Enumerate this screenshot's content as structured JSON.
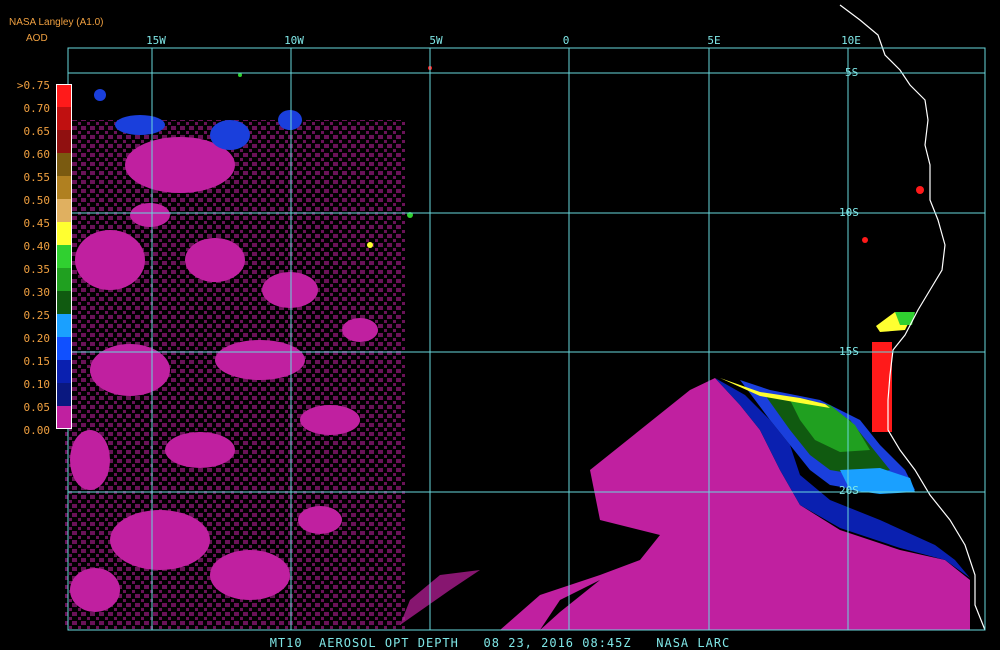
{
  "header": {
    "source": "NASA Langley (A1.0)",
    "product": "AOD"
  },
  "longitude_labels": [
    "15W",
    "10W",
    "5W",
    "0",
    "5E",
    "10E"
  ],
  "latitude_labels": [
    "5S",
    "10S",
    "15S",
    "20S"
  ],
  "legend": {
    "labels": [
      ">0.75",
      "0.70",
      "0.65",
      "0.60",
      "0.55",
      "0.50",
      "0.45",
      "0.40",
      "0.35",
      "0.30",
      "0.25",
      "0.20",
      "0.15",
      "0.10",
      "0.05",
      "0.00"
    ],
    "colors": [
      "#ff1a1a",
      "#c01010",
      "#901010",
      "#7a5a10",
      "#b08020",
      "#e0b060",
      "#ffff30",
      "#30d030",
      "#20a020",
      "#105a10",
      "#1aa0ff",
      "#1050ff",
      "#0a20b0",
      "#0a1880",
      "#c020a0",
      "#ffffff"
    ]
  },
  "colors": {
    "grid": "#69d8dc",
    "coast": "#ffffff",
    "background": "#000000",
    "label": "#7fe6e6",
    "header": "#f0a040"
  },
  "footer": {
    "text": "MT10  AEROSOL OPT DEPTH   08 23, 2016 08:45Z   NASA LARC"
  }
}
